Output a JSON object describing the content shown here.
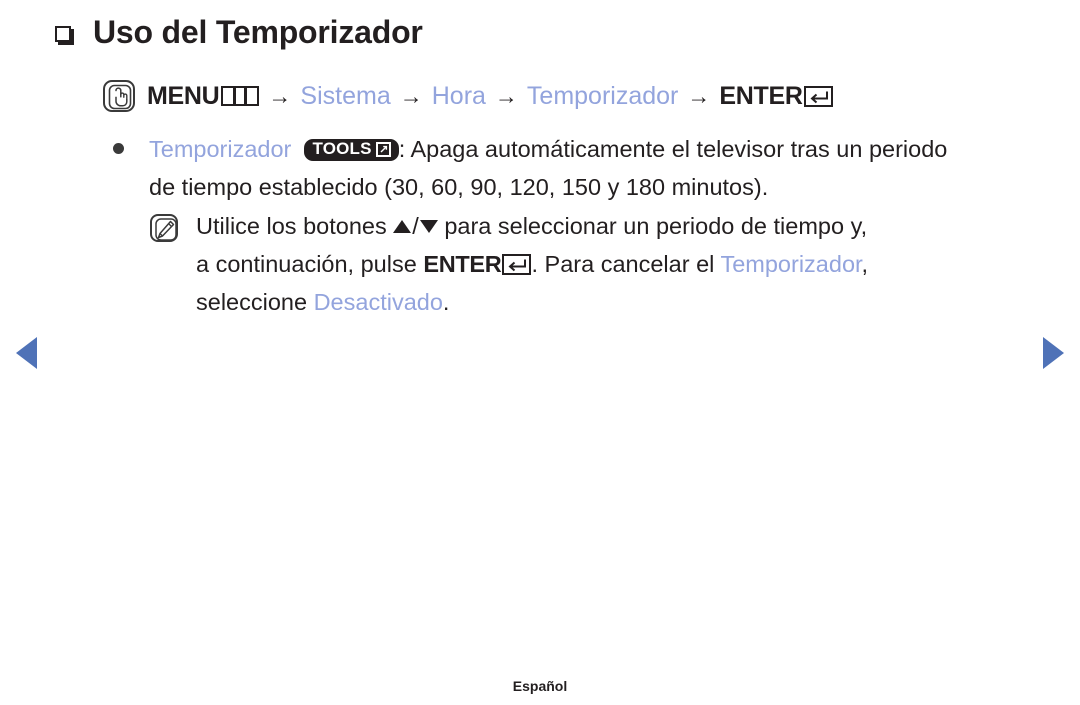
{
  "page": {
    "title": "Uso del Temporizador",
    "language_footer": "Español"
  },
  "menu_path": {
    "press_icon": "hand-press-icon",
    "menu_label": "MENU",
    "menu_glyph": "menu-cells-icon",
    "arrow": "→",
    "step_system": "Sistema",
    "step_time": "Hora",
    "step_timer": "Temporizador",
    "enter_label": "ENTER",
    "enter_glyph": "return-key-icon"
  },
  "content": {
    "bullet": {
      "term": "Temporizador",
      "tools_badge": "TOOLS",
      "tools_glyph": "arrow-out-of-box-icon",
      "description_part1": ": Apaga automáticamente el televisor tras un periodo",
      "description_part2": "de tiempo establecido (30, 60, 90, 120, 150 y 180 minutos)."
    },
    "note": {
      "icon": "note-pencil-icon",
      "text_before_arrows": "Utilice los botones",
      "arrow_up": "▲",
      "separator": "/",
      "arrow_down": "▼",
      "text_after_arrows": "para seleccionar un periodo de tiempo y,",
      "line2_part1": "a continuación, pulse",
      "line2_enter": "ENTER",
      "line2_enter_glyph": "return-key-icon",
      "line2_part2": ". Para cancelar el",
      "line2_highlight": "Temporizador",
      "line2_part3": ",",
      "line3_part1": "seleccione",
      "line3_highlight": "Desactivado",
      "line3_part2": "."
    }
  },
  "navigation": {
    "prev_label": "prev-page-arrow",
    "next_label": "next-page-arrow"
  },
  "colors": {
    "accent_blue": "#93a4dd",
    "nav_arrow_blue": "#4f72b7",
    "text_dark": "#231f20",
    "badge_dark": "#231f20"
  }
}
